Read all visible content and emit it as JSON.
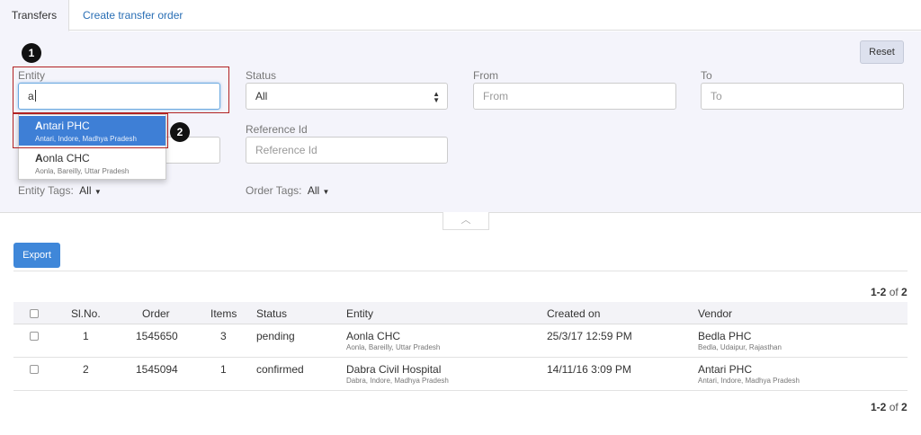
{
  "tabs": [
    {
      "label": "Transfers"
    },
    {
      "label": "Create transfer order"
    }
  ],
  "filters": {
    "reset_label": "Reset",
    "entity": {
      "label": "Entity",
      "value": "a"
    },
    "status": {
      "label": "Status",
      "value": "All"
    },
    "from": {
      "label": "From",
      "placeholder": "From"
    },
    "to": {
      "label": "To",
      "placeholder": "To"
    },
    "reference": {
      "label": "Reference Id",
      "placeholder": "Reference Id"
    },
    "entity_tags": {
      "label": "Entity Tags:",
      "value": "All"
    },
    "order_tags": {
      "label": "Order Tags:",
      "value": "All"
    }
  },
  "autocomplete": [
    {
      "name_bold": "A",
      "name_rest": "ntari PHC",
      "location": "Antari, Indore, Madhya Pradesh"
    },
    {
      "name_bold": "A",
      "name_rest": "onla CHC",
      "location": "Aonla, Bareilly, Uttar Pradesh"
    }
  ],
  "annotations": {
    "badge1": "1",
    "badge2": "2"
  },
  "export_label": "Export",
  "pager": {
    "range": "1-2",
    "of": "of",
    "total": "2"
  },
  "table": {
    "headers": [
      "Sl.No.",
      "Order",
      "Items",
      "Status",
      "Entity",
      "Created on",
      "Vendor"
    ],
    "rows": [
      {
        "slno": "1",
        "order": "1545650",
        "items": "3",
        "status": "pending",
        "entity": "Aonla CHC",
        "entity_loc": "Aonla, Bareilly, Uttar Pradesh",
        "created": "25/3/17 12:59 PM",
        "vendor": "Bedla PHC",
        "vendor_loc": "Bedla, Udaipur, Rajasthan"
      },
      {
        "slno": "2",
        "order": "1545094",
        "items": "1",
        "status": "confirmed",
        "entity": "Dabra Civil Hospital",
        "entity_loc": "Dabra, Indore, Madhya Pradesh",
        "created": "14/11/16 3:09 PM",
        "vendor": "Antari PHC",
        "vendor_loc": "Antari, Indore, Madhya Pradesh"
      }
    ]
  }
}
